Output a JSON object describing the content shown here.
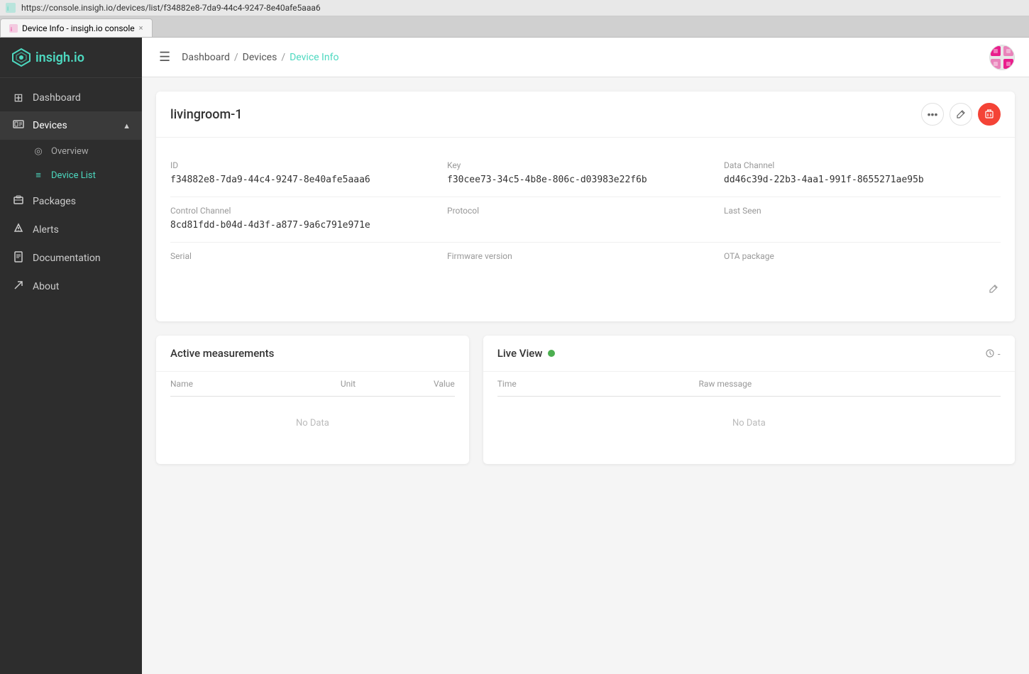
{
  "browser": {
    "url": "https://console.insigh.io/devices/list/f34882e8-7da9-44c4-9247-8e40afe5aaa6",
    "tab_label": "Device Info - insigh.io console",
    "tab_close": "×"
  },
  "topbar": {
    "breadcrumbs": [
      "Dashboard",
      "Devices",
      "Device Info"
    ],
    "separators": [
      "/",
      "/"
    ]
  },
  "sidebar": {
    "logo": "insigh.io",
    "nav_items": [
      {
        "id": "dashboard",
        "label": "Dashboard",
        "icon": "⊞"
      },
      {
        "id": "devices",
        "label": "Devices",
        "icon": "⬡",
        "expanded": true
      },
      {
        "id": "packages",
        "label": "Packages",
        "icon": "📦"
      },
      {
        "id": "alerts",
        "label": "Alerts",
        "icon": "🔔"
      },
      {
        "id": "documentation",
        "label": "Documentation",
        "icon": "📄"
      },
      {
        "id": "about",
        "label": "About",
        "icon": "↗"
      }
    ],
    "sub_items": [
      {
        "id": "overview",
        "label": "Overview",
        "icon": "◎"
      },
      {
        "id": "device-list",
        "label": "Device List",
        "icon": "≡"
      }
    ]
  },
  "device": {
    "name": "livingroom-1",
    "fields": {
      "id_label": "ID",
      "id_value": "f34882e8-7da9-44c4-9247-8e40afe5aaa6",
      "key_label": "Key",
      "key_value": "f30cee73-34c5-4b8e-806c-d03983e22f6b",
      "data_channel_label": "Data Channel",
      "data_channel_value": "dd46c39d-22b3-4aa1-991f-8655271ae95b",
      "control_channel_label": "Control Channel",
      "control_channel_value": "8cd81fdd-b04d-4d3f-a877-9a6c791e971e",
      "protocol_label": "Protocol",
      "protocol_value": "",
      "last_seen_label": "Last Seen",
      "last_seen_value": "",
      "serial_label": "Serial",
      "serial_value": "",
      "firmware_label": "Firmware version",
      "firmware_value": "",
      "ota_label": "OTA package",
      "ota_value": ""
    }
  },
  "active_measurements": {
    "title": "Active measurements",
    "col_name": "Name",
    "col_unit": "Unit",
    "col_value": "Value",
    "no_data": "No Data"
  },
  "live_view": {
    "title": "Live View",
    "status": "online",
    "col_time": "Time",
    "col_raw": "Raw message",
    "no_data": "No Data",
    "timer_label": "-"
  }
}
